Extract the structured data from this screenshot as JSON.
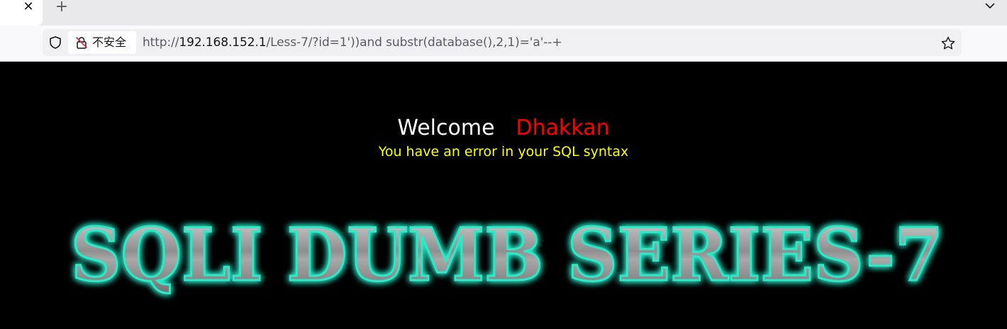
{
  "browser": {
    "tab_close_glyph": "✕",
    "new_tab_glyph": "+",
    "security_label": "不安全",
    "url": {
      "scheme": "http://",
      "host": "192.168.152.1",
      "path": "/Less-7/?id=1'))and substr(database(),2,1)='a'--+"
    },
    "icons": [
      "close-icon",
      "plus-icon",
      "chevron-down-icon",
      "shield-icon",
      "insecure-lock-icon",
      "star-icon"
    ]
  },
  "page": {
    "welcome": "Welcome",
    "name": "Dhakkan",
    "error": "You have an error in your SQL syntax",
    "banner_text": "SQLI DUMB SERIES-7",
    "colors": {
      "background": "#000000",
      "welcome": "#ffffff",
      "name": "#ff0000",
      "error": "#ffff00",
      "banner_glow": "#2ee8c8",
      "banner_fill": "#9a9a9a"
    }
  }
}
